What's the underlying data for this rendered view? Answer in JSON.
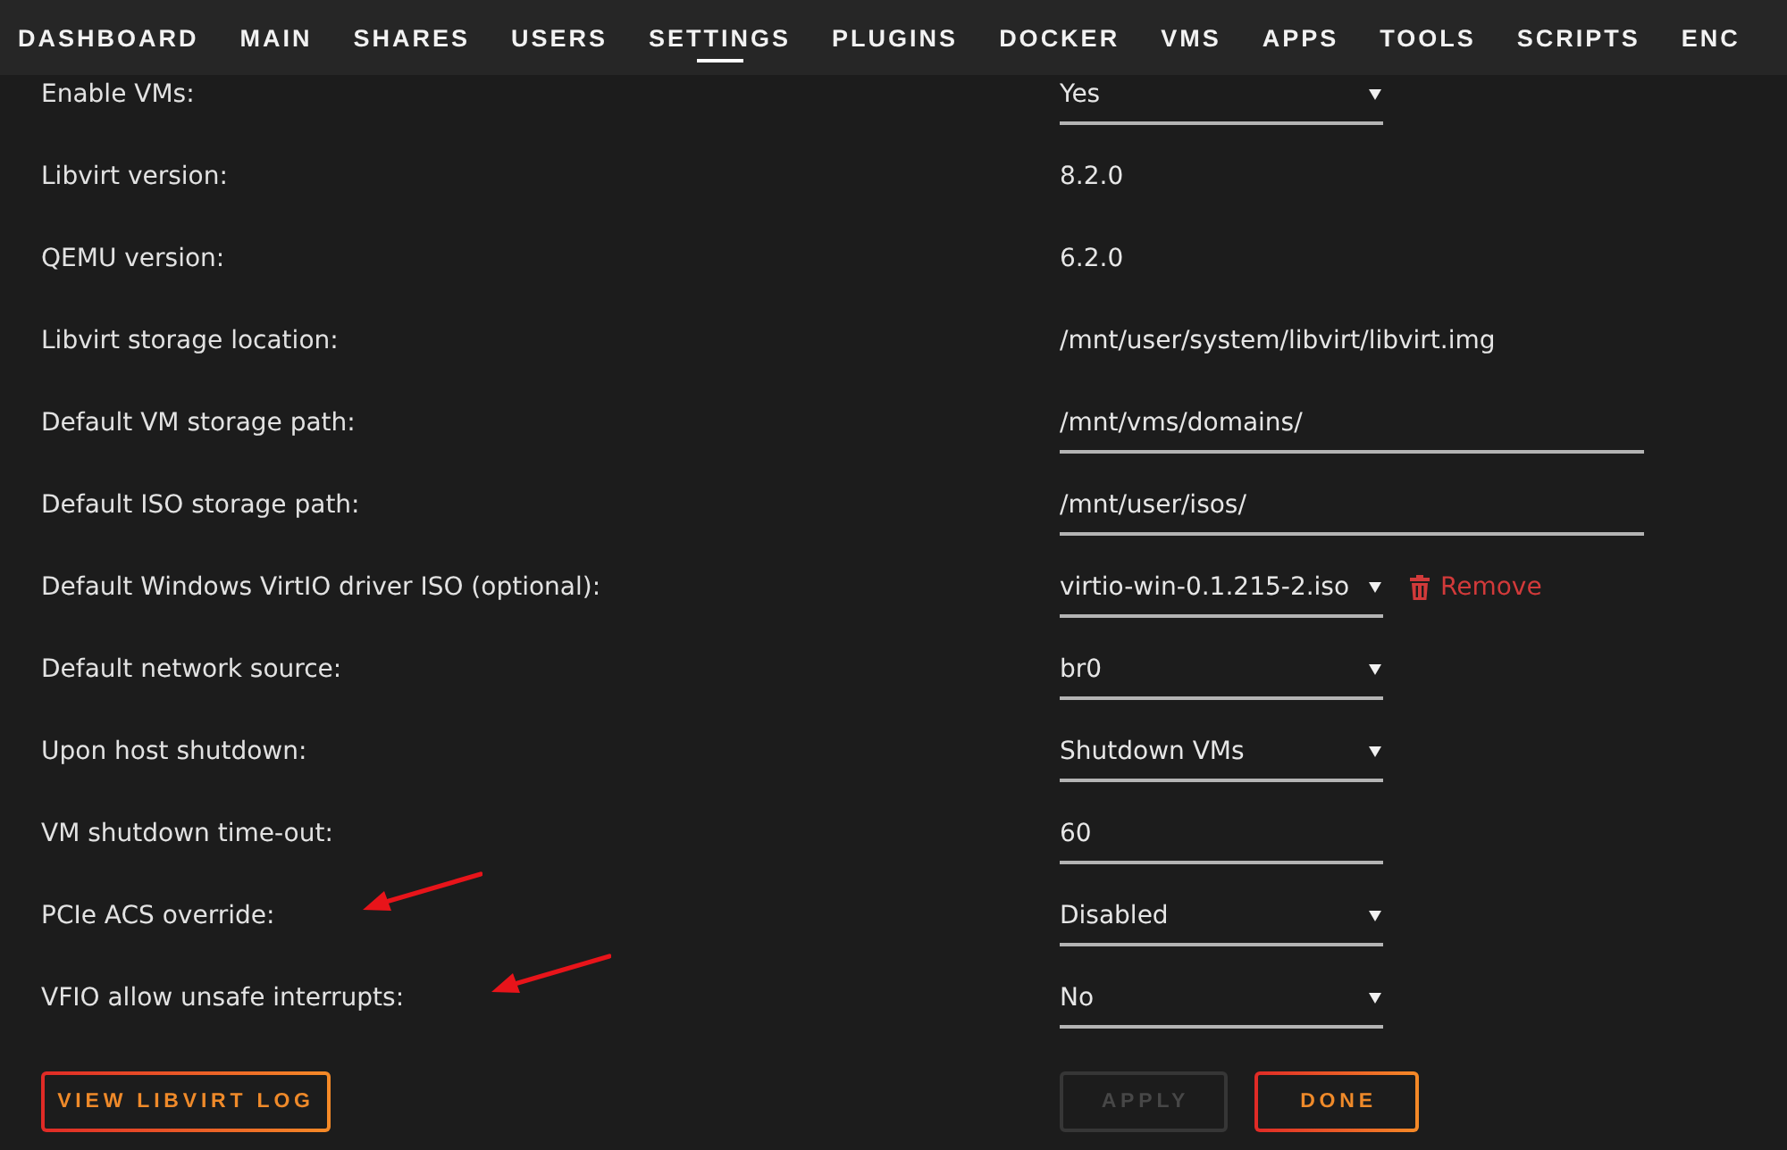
{
  "nav": {
    "tabs": [
      {
        "label": "DASHBOARD",
        "selected": false
      },
      {
        "label": "MAIN",
        "selected": false
      },
      {
        "label": "SHARES",
        "selected": false
      },
      {
        "label": "USERS",
        "selected": false
      },
      {
        "label": "SETTINGS",
        "selected": true
      },
      {
        "label": "PLUGINS",
        "selected": false
      },
      {
        "label": "DOCKER",
        "selected": false
      },
      {
        "label": "VMS",
        "selected": false
      },
      {
        "label": "APPS",
        "selected": false
      },
      {
        "label": "TOOLS",
        "selected": false
      },
      {
        "label": "SCRIPTS",
        "selected": false
      },
      {
        "label": "ENC",
        "selected": false
      }
    ]
  },
  "settings": [
    {
      "label": "Enable VMs:",
      "kind": "select",
      "value": "Yes",
      "annotated": false
    },
    {
      "label": "Libvirt version:",
      "kind": "text",
      "value": "8.2.0",
      "annotated": false
    },
    {
      "label": "QEMU version:",
      "kind": "text",
      "value": "6.2.0",
      "annotated": false
    },
    {
      "label": "Libvirt storage location:",
      "kind": "text",
      "value": "/mnt/user/system/libvirt/libvirt.img",
      "annotated": false
    },
    {
      "label": "Default VM storage path:",
      "kind": "path",
      "value": "/mnt/vms/domains/",
      "annotated": false
    },
    {
      "label": "Default ISO storage path:",
      "kind": "path",
      "value": "/mnt/user/isos/",
      "annotated": false
    },
    {
      "label": "Default Windows VirtIO driver ISO (optional):",
      "kind": "select",
      "value": "virtio-win-0.1.215-2.iso",
      "annotated": false,
      "action": {
        "label": "Remove"
      }
    },
    {
      "label": "Default network source:",
      "kind": "select",
      "value": "br0",
      "annotated": false
    },
    {
      "label": "Upon host shutdown:",
      "kind": "select",
      "value": "Shutdown VMs",
      "annotated": false
    },
    {
      "label": "VM shutdown time-out:",
      "kind": "number",
      "value": "60",
      "annotated": false
    },
    {
      "label": "PCIe ACS override:",
      "kind": "select",
      "value": "Disabled",
      "annotated": true
    },
    {
      "label": "VFIO allow unsafe interrupts:",
      "kind": "select",
      "value": "No",
      "annotated": true
    }
  ],
  "footer": {
    "log_button": {
      "label": "VIEW LIBVIRT LOG",
      "disabled": false
    },
    "actions": [
      {
        "label": "APPLY",
        "disabled": true
      },
      {
        "label": "DONE",
        "disabled": false
      }
    ]
  }
}
